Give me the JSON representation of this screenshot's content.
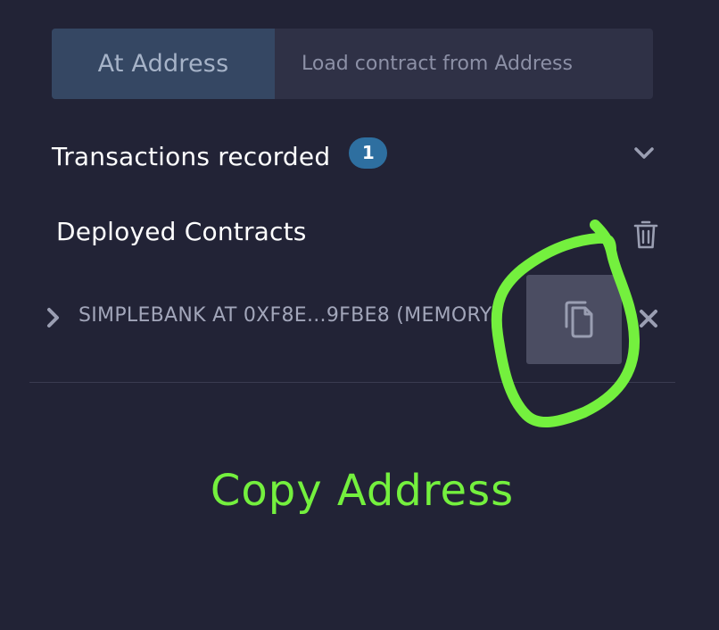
{
  "at_address": {
    "button_label": "At Address",
    "input_placeholder": "Load contract from Address"
  },
  "transactions": {
    "title": "Transactions recorded",
    "count": "1"
  },
  "deployed_contracts": {
    "title": "Deployed Contracts",
    "items": [
      {
        "label": "SIMPLEBANK AT 0XF8E...9FBE8 (MEMORY)"
      }
    ]
  },
  "annotation": {
    "caption": "Copy Address",
    "color": "#74f03e"
  },
  "icons": {
    "expand_transactions": "chevron-down-icon",
    "clear_instances": "trash-icon",
    "expand_contract": "chevron-right-icon",
    "copy_address": "copy-icon",
    "remove_contract": "close-icon"
  },
  "colors": {
    "background": "#222336",
    "panel": "#2f3146",
    "primary_button": "#354763",
    "badge": "#2e6fa0",
    "copy_button": "#4b4d62"
  }
}
